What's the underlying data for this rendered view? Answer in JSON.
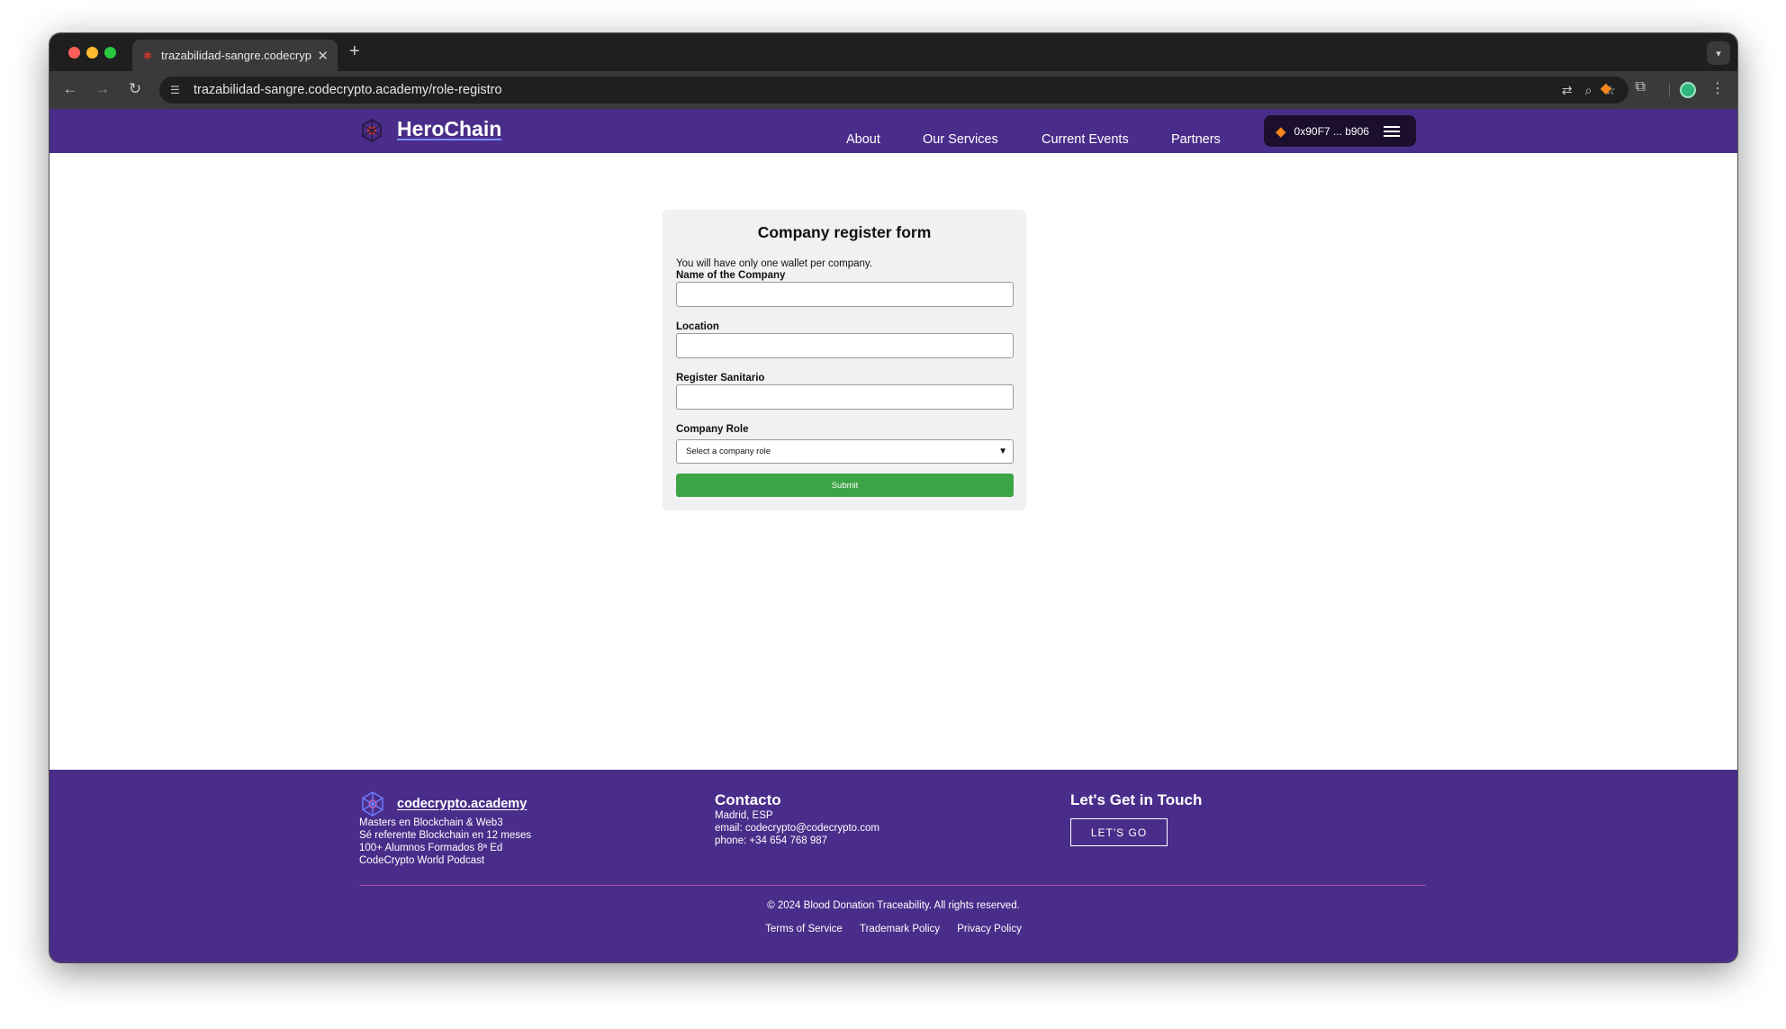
{
  "browser": {
    "tab_title": "trazabilidad-sangre.codecrypto",
    "new_tab": "+",
    "url": "trazabilidad-sangre.codecrypto.academy/role-registro"
  },
  "header": {
    "brand": "HeroChain",
    "nav": [
      "About",
      "Our Services",
      "Current Events",
      "Partners"
    ],
    "wallet_address": "0x90F7 ... b906"
  },
  "form": {
    "title": "Company register form",
    "note": "You will have only one wallet per company.",
    "fields": [
      {
        "label": "Name of the Company",
        "value": ""
      },
      {
        "label": "Location",
        "value": ""
      },
      {
        "label": "Register Sanitario",
        "value": ""
      }
    ],
    "role_label": "Company Role",
    "role_selected": "Select a company role",
    "submit": "Submit"
  },
  "footer": {
    "brand": "codecrypto.academy",
    "brand_lines": [
      "Masters en Blockchain & Web3",
      "Sé referente Blockchain en 12 meses",
      "100+ Alumnos Formados 8ª Ed",
      "CodeCrypto World Podcast"
    ],
    "contact_title": "Contacto",
    "contact_lines": [
      "Madrid, ESP",
      "email: codecrypto@codecrypto.com",
      "phone: +34 654 768 987"
    ],
    "touch_title": "Let's Get in Touch",
    "cta": "LET'S GO",
    "copyright": "© 2024 Blood Donation Traceability. All rights reserved.",
    "links": [
      "Terms of Service",
      "Trademark Policy",
      "Privacy Policy"
    ]
  },
  "colors": {
    "brand_purple": "#4a2d8a",
    "submit_green": "#3da446",
    "wallet_bg": "#1c0f2e"
  },
  "icons": [
    "close-icon",
    "back-icon",
    "forward-icon",
    "reload-icon",
    "site-settings-icon",
    "translate-icon",
    "zoom-icon",
    "bookmark-star-icon",
    "metamask-fox-icon",
    "extensions-icon",
    "profile-icon",
    "more-menu-icon",
    "hamburger-icon",
    "chevron-down-icon"
  ]
}
